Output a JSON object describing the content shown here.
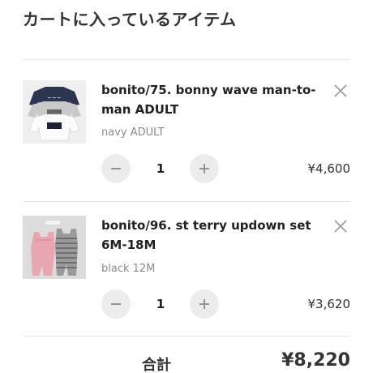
{
  "header": {
    "title": "カートに入っているアイテム"
  },
  "cart": {
    "items": [
      {
        "name": "bonito/75. bonny wave man-to-man ADULT",
        "variant": "navy ADULT",
        "quantity": "1",
        "price": "¥4,600",
        "image_icon": "sweatshirts-product-photo"
      },
      {
        "name": "bonito/96. st terry updown set 6M-18M",
        "variant": "black 12M",
        "quantity": "1",
        "price": "¥3,620",
        "image_icon": "baby-rompers-product-photo"
      }
    ],
    "total_label": "合計",
    "total_value": "¥8,220"
  },
  "icons": {
    "remove": "close-icon",
    "decrease": "minus-icon",
    "increase": "plus-icon"
  }
}
